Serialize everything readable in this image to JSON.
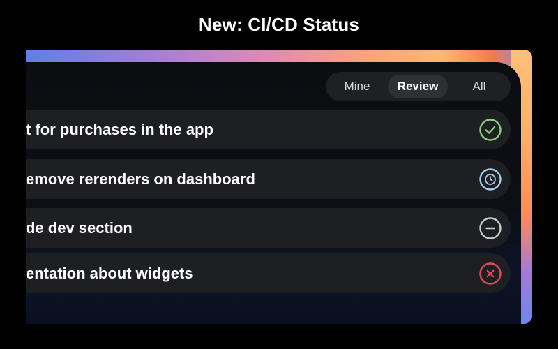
{
  "header": {
    "title": "New: CI/CD Status"
  },
  "filters": {
    "tabs": [
      {
        "label": "Mine",
        "selected": false
      },
      {
        "label": "Review",
        "selected": true
      },
      {
        "label": "All",
        "selected": false
      }
    ]
  },
  "items": [
    {
      "label": "t for purchases in the app",
      "status": "success",
      "icon": "check-circle-icon",
      "color": "#8fce7a"
    },
    {
      "label": "emove rerenders on dashboard",
      "status": "pending",
      "icon": "clock-circle-icon",
      "color": "#a9cde6"
    },
    {
      "label": "de dev section",
      "status": "skipped",
      "icon": "minus-circle-icon",
      "color": "#c9cbd0"
    },
    {
      "label": "entation about widgets",
      "status": "failed",
      "icon": "x-circle-icon",
      "color": "#e34b5a"
    }
  ]
}
